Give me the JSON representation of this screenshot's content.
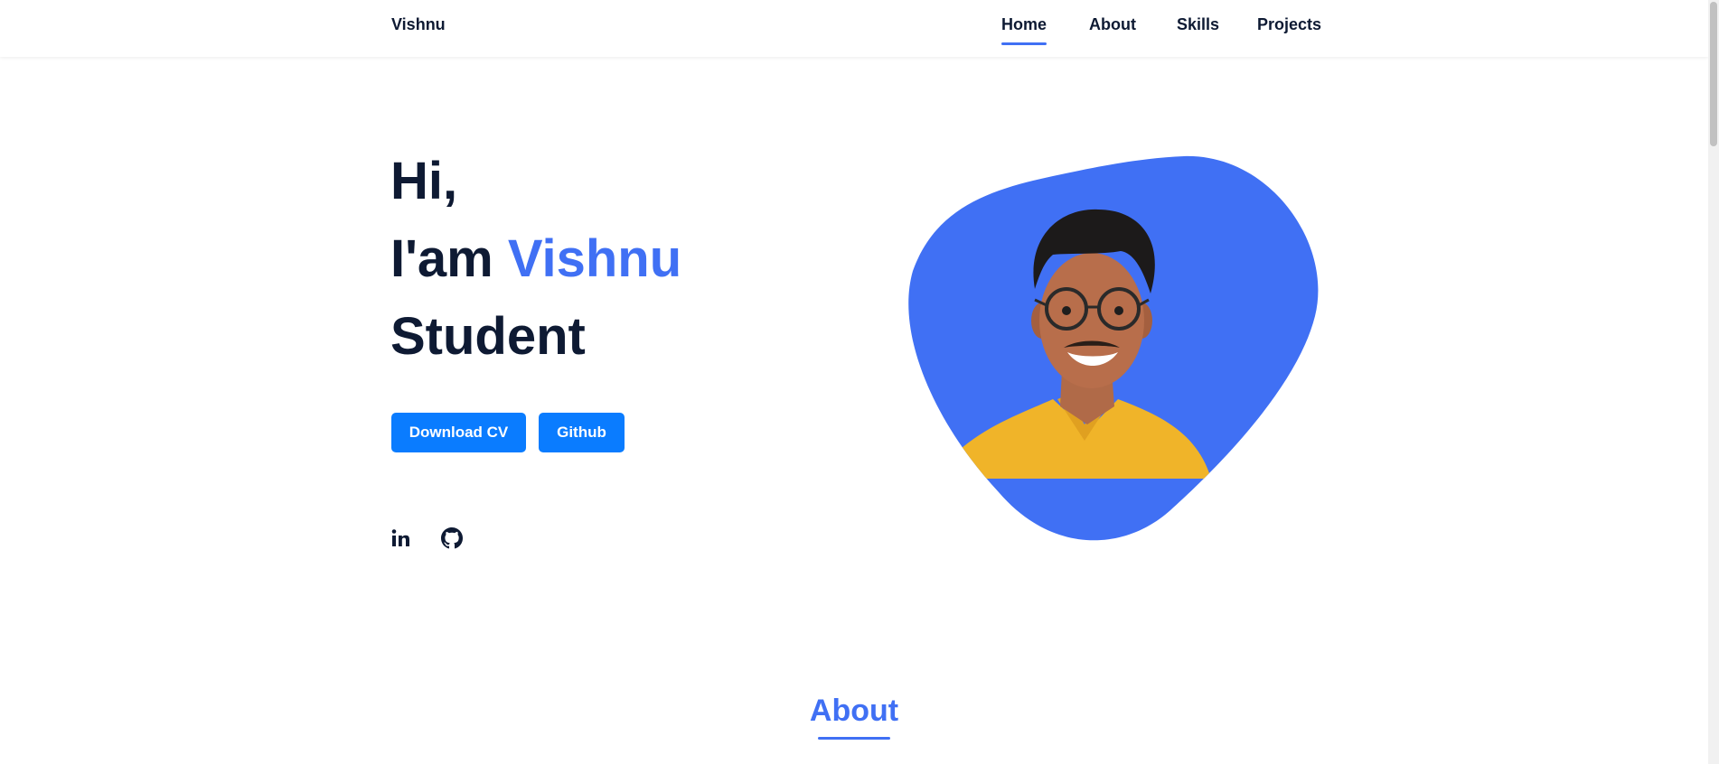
{
  "header": {
    "logo": "Vishnu",
    "nav": [
      {
        "label": "Home",
        "active": true
      },
      {
        "label": "About",
        "active": false
      },
      {
        "label": "Skills",
        "active": false
      },
      {
        "label": "Projects",
        "active": false
      }
    ]
  },
  "hero": {
    "line1": "Hi,",
    "line2_prefix": "I'am ",
    "line2_name": "Vishnu",
    "line3": "Student",
    "buttons": {
      "cv": "Download CV",
      "github": "Github"
    },
    "social": [
      {
        "icon": "linkedin-icon",
        "text": "in"
      },
      {
        "icon": "github-icon"
      }
    ],
    "image": {
      "subject": "person-portrait"
    }
  },
  "about": {
    "title": "About"
  },
  "colors": {
    "accent": "#4070f4",
    "button": "#0a7cff",
    "text": "#0e1a33"
  }
}
